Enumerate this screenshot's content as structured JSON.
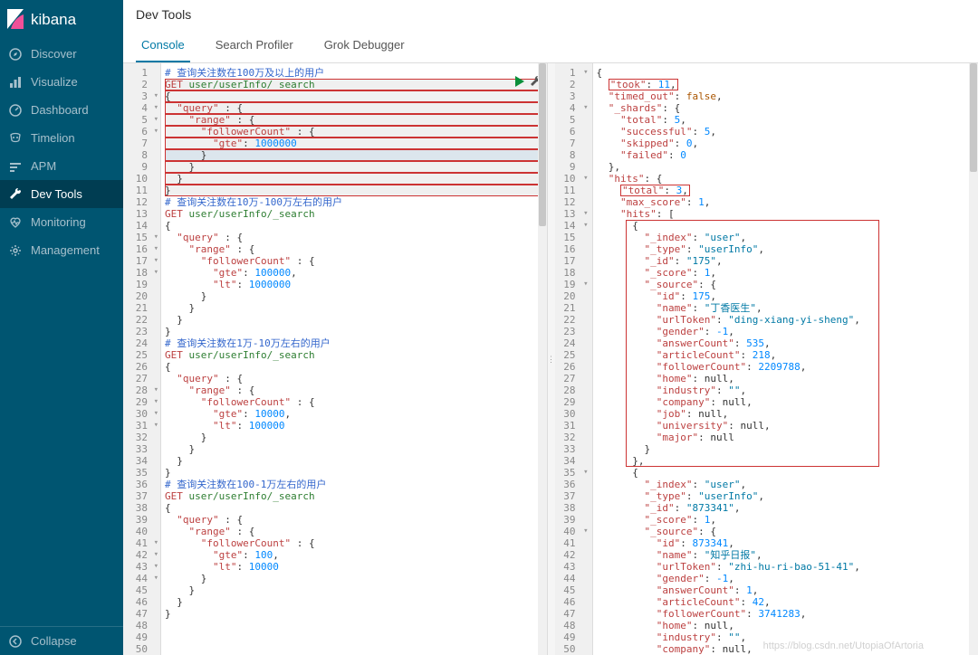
{
  "brand": {
    "name": "kibana"
  },
  "sidebar": {
    "items": [
      {
        "label": "Discover",
        "icon": "compass-icon"
      },
      {
        "label": "Visualize",
        "icon": "barchart-icon"
      },
      {
        "label": "Dashboard",
        "icon": "gauge-icon"
      },
      {
        "label": "Timelion",
        "icon": "timelion-icon"
      },
      {
        "label": "APM",
        "icon": "apm-icon"
      },
      {
        "label": "Dev Tools",
        "icon": "wrench-icon",
        "active": true
      },
      {
        "label": "Monitoring",
        "icon": "heartbeat-icon"
      },
      {
        "label": "Management",
        "icon": "gear-icon"
      }
    ],
    "collapse_label": "Collapse"
  },
  "header": {
    "title": "Dev Tools",
    "tabs": [
      {
        "label": "Console",
        "active": true
      },
      {
        "label": "Search Profiler"
      },
      {
        "label": "Grok Debugger"
      }
    ]
  },
  "editor": {
    "active_region": {
      "from": 2,
      "to": 12
    },
    "lines": [
      {
        "n": 1,
        "type": "comment",
        "text": "# 查询关注数在100万及以上的用户"
      },
      {
        "n": 2,
        "type": "request",
        "method": "GET",
        "path": "user/userInfo/_search"
      },
      {
        "n": 3,
        "type": "brace_open",
        "text": "{"
      },
      {
        "n": 4,
        "type": "kv_open",
        "indent": 1,
        "key": "query"
      },
      {
        "n": 5,
        "type": "kv_open",
        "indent": 2,
        "key": "range"
      },
      {
        "n": 6,
        "type": "kv_open",
        "indent": 3,
        "key": "followerCount"
      },
      {
        "n": 7,
        "type": "kv_num",
        "indent": 4,
        "key": "gte",
        "val": 1000000
      },
      {
        "n": 8,
        "type": "brace_close",
        "indent": 3,
        "highlight": true
      },
      {
        "n": 9,
        "type": "brace_close",
        "indent": 2
      },
      {
        "n": 10,
        "type": "brace_close",
        "indent": 1
      },
      {
        "n": 11,
        "type": "brace_close",
        "indent": 0
      },
      {
        "n": 12,
        "type": "blank"
      },
      {
        "n": 13,
        "type": "comment",
        "text": "# 查询关注数在10万-100万左右的用户"
      },
      {
        "n": 14,
        "type": "request",
        "method": "GET",
        "path": "user/userInfo/_search"
      },
      {
        "n": 15,
        "type": "brace_open",
        "text": "{"
      },
      {
        "n": 16,
        "type": "kv_open",
        "indent": 1,
        "key": "query"
      },
      {
        "n": 17,
        "type": "kv_open",
        "indent": 2,
        "key": "range"
      },
      {
        "n": 18,
        "type": "kv_open",
        "indent": 3,
        "key": "followerCount"
      },
      {
        "n": 19,
        "type": "kv_num_comma",
        "indent": 4,
        "key": "gte",
        "val": 100000
      },
      {
        "n": 20,
        "type": "kv_num",
        "indent": 4,
        "key": "lt",
        "val": 1000000
      },
      {
        "n": 21,
        "type": "brace_close",
        "indent": 3
      },
      {
        "n": 22,
        "type": "brace_close",
        "indent": 2
      },
      {
        "n": 23,
        "type": "brace_close",
        "indent": 1
      },
      {
        "n": 24,
        "type": "brace_close",
        "indent": 0
      },
      {
        "n": 25,
        "type": "blank"
      },
      {
        "n": 26,
        "type": "comment",
        "text": "# 查询关注数在1万-10万左右的用户"
      },
      {
        "n": 27,
        "type": "request",
        "method": "GET",
        "path": "user/userInfo/_search"
      },
      {
        "n": 28,
        "type": "brace_open",
        "text": "{"
      },
      {
        "n": 29,
        "type": "kv_open",
        "indent": 1,
        "key": "query"
      },
      {
        "n": 30,
        "type": "kv_open",
        "indent": 2,
        "key": "range"
      },
      {
        "n": 31,
        "type": "kv_open",
        "indent": 3,
        "key": "followerCount"
      },
      {
        "n": 32,
        "type": "kv_num_comma",
        "indent": 4,
        "key": "gte",
        "val": 10000
      },
      {
        "n": 33,
        "type": "kv_num",
        "indent": 4,
        "key": "lt",
        "val": 100000
      },
      {
        "n": 34,
        "type": "brace_close",
        "indent": 3
      },
      {
        "n": 35,
        "type": "brace_close",
        "indent": 2
      },
      {
        "n": 36,
        "type": "brace_close",
        "indent": 1
      },
      {
        "n": 37,
        "type": "brace_close",
        "indent": 0
      },
      {
        "n": 38,
        "type": "blank"
      },
      {
        "n": 39,
        "type": "comment",
        "text": "# 查询关注数在100-1万左右的用户"
      },
      {
        "n": 40,
        "type": "request",
        "method": "GET",
        "path": "user/userInfo/_search"
      },
      {
        "n": 41,
        "type": "brace_open",
        "text": "{"
      },
      {
        "n": 42,
        "type": "kv_open",
        "indent": 1,
        "key": "query"
      },
      {
        "n": 43,
        "type": "kv_open",
        "indent": 2,
        "key": "range"
      },
      {
        "n": 44,
        "type": "kv_open",
        "indent": 3,
        "key": "followerCount"
      },
      {
        "n": 45,
        "type": "kv_num_comma",
        "indent": 4,
        "key": "gte",
        "val": 100
      },
      {
        "n": 46,
        "type": "kv_num",
        "indent": 4,
        "key": "lt",
        "val": 10000
      },
      {
        "n": 47,
        "type": "brace_close",
        "indent": 3
      },
      {
        "n": 48,
        "type": "brace_close",
        "indent": 2
      },
      {
        "n": 49,
        "type": "brace_close",
        "indent": 1
      },
      {
        "n": 50,
        "type": "brace_close",
        "indent": 0
      }
    ]
  },
  "response": {
    "lines": [
      {
        "n": 1,
        "raw": "{",
        "fold": true
      },
      {
        "n": 2,
        "raw": "  &quot;took&quot;: 11,",
        "redbox": true,
        "kv": {
          "key": "took",
          "num": 11,
          "comma": true
        }
      },
      {
        "n": 3,
        "kv": {
          "key": "timed_out",
          "bool": "false",
          "comma": true
        },
        "indent": 1
      },
      {
        "n": 4,
        "kv": {
          "key": "_shards",
          "open": true
        },
        "indent": 1,
        "fold": true
      },
      {
        "n": 5,
        "kv": {
          "key": "total",
          "num": 5,
          "comma": true
        },
        "indent": 2
      },
      {
        "n": 6,
        "kv": {
          "key": "successful",
          "num": 5,
          "comma": true
        },
        "indent": 2
      },
      {
        "n": 7,
        "kv": {
          "key": "skipped",
          "num": 0,
          "comma": true
        },
        "indent": 2
      },
      {
        "n": 8,
        "kv": {
          "key": "failed",
          "num": 0
        },
        "indent": 2
      },
      {
        "n": 9,
        "raw": "  },",
        "close": true,
        "indent": 1
      },
      {
        "n": 10,
        "kv": {
          "key": "hits",
          "open": true
        },
        "indent": 1,
        "fold": true
      },
      {
        "n": 11,
        "kv": {
          "key": "total",
          "num": 3,
          "comma": true
        },
        "indent": 2,
        "redbox": true
      },
      {
        "n": 12,
        "kv": {
          "key": "max_score",
          "num": 1,
          "comma": true
        },
        "indent": 2
      },
      {
        "n": 13,
        "kv": {
          "key": "hits",
          "arr_open": true
        },
        "indent": 2,
        "fold": true
      },
      {
        "n": 14,
        "raw": "      {",
        "indent": 3,
        "fold": true,
        "redbox_start": true
      },
      {
        "n": 15,
        "kv": {
          "key": "_index",
          "str": "user",
          "comma": true
        },
        "indent": 4
      },
      {
        "n": 16,
        "kv": {
          "key": "_type",
          "str": "userInfo",
          "comma": true
        },
        "indent": 4
      },
      {
        "n": 17,
        "kv": {
          "key": "_id",
          "str": "175",
          "comma": true
        },
        "indent": 4
      },
      {
        "n": 18,
        "kv": {
          "key": "_score",
          "num": 1,
          "comma": true
        },
        "indent": 4
      },
      {
        "n": 19,
        "kv": {
          "key": "_source",
          "open": true
        },
        "indent": 4,
        "fold": true
      },
      {
        "n": 20,
        "kv": {
          "key": "id",
          "num": 175,
          "comma": true
        },
        "indent": 5
      },
      {
        "n": 21,
        "kv": {
          "key": "name",
          "str": "丁香医生",
          "comma": true
        },
        "indent": 5
      },
      {
        "n": 22,
        "kv": {
          "key": "urlToken",
          "str": "ding-xiang-yi-sheng",
          "comma": true
        },
        "indent": 5
      },
      {
        "n": 23,
        "kv": {
          "key": "gender",
          "num": -1,
          "comma": true
        },
        "indent": 5
      },
      {
        "n": 24,
        "kv": {
          "key": "answerCount",
          "num": 535,
          "comma": true
        },
        "indent": 5
      },
      {
        "n": 25,
        "kv": {
          "key": "articleCount",
          "num": 218,
          "comma": true
        },
        "indent": 5
      },
      {
        "n": 26,
        "kv": {
          "key": "followerCount",
          "num": 2209788,
          "comma": true
        },
        "indent": 5
      },
      {
        "n": 27,
        "kv": {
          "key": "home",
          "null": true,
          "comma": true
        },
        "indent": 5
      },
      {
        "n": 28,
        "kv": {
          "key": "industry",
          "str": "",
          "comma": true
        },
        "indent": 5
      },
      {
        "n": 29,
        "kv": {
          "key": "company",
          "null": true,
          "comma": true
        },
        "indent": 5
      },
      {
        "n": 30,
        "kv": {
          "key": "job",
          "null": true,
          "comma": true
        },
        "indent": 5
      },
      {
        "n": 31,
        "kv": {
          "key": "university",
          "null": true,
          "comma": true
        },
        "indent": 5
      },
      {
        "n": 32,
        "kv": {
          "key": "major",
          "null": true
        },
        "indent": 5
      },
      {
        "n": 33,
        "raw": "        }",
        "close": true,
        "indent": 4
      },
      {
        "n": 34,
        "raw": "      },",
        "close": true,
        "indent": 3,
        "redbox_end": true
      },
      {
        "n": 35,
        "raw": "      {",
        "indent": 3,
        "fold": true
      },
      {
        "n": 36,
        "kv": {
          "key": "_index",
          "str": "user",
          "comma": true
        },
        "indent": 4
      },
      {
        "n": 37,
        "kv": {
          "key": "_type",
          "str": "userInfo",
          "comma": true
        },
        "indent": 4
      },
      {
        "n": 38,
        "kv": {
          "key": "_id",
          "str": "873341",
          "comma": true
        },
        "indent": 4
      },
      {
        "n": 39,
        "kv": {
          "key": "_score",
          "num": 1,
          "comma": true
        },
        "indent": 4
      },
      {
        "n": 40,
        "kv": {
          "key": "_source",
          "open": true
        },
        "indent": 4,
        "fold": true
      },
      {
        "n": 41,
        "kv": {
          "key": "id",
          "num": 873341,
          "comma": true
        },
        "indent": 5
      },
      {
        "n": 42,
        "kv": {
          "key": "name",
          "str": "知乎日报",
          "comma": true
        },
        "indent": 5
      },
      {
        "n": 43,
        "kv": {
          "key": "urlToken",
          "str": "zhi-hu-ri-bao-51-41",
          "comma": true
        },
        "indent": 5
      },
      {
        "n": 44,
        "kv": {
          "key": "gender",
          "num": -1,
          "comma": true
        },
        "indent": 5
      },
      {
        "n": 45,
        "kv": {
          "key": "answerCount",
          "num": 1,
          "comma": true
        },
        "indent": 5
      },
      {
        "n": 46,
        "kv": {
          "key": "articleCount",
          "num": 42,
          "comma": true
        },
        "indent": 5
      },
      {
        "n": 47,
        "kv": {
          "key": "followerCount",
          "num": 3741283,
          "comma": true
        },
        "indent": 5
      },
      {
        "n": 48,
        "kv": {
          "key": "home",
          "null": true,
          "comma": true
        },
        "indent": 5
      },
      {
        "n": 49,
        "kv": {
          "key": "industry",
          "str": "",
          "comma": true
        },
        "indent": 5
      },
      {
        "n": 50,
        "kv": {
          "key": "company",
          "null": true,
          "comma": true
        },
        "indent": 5
      }
    ]
  },
  "watermark": "https://blog.csdn.net/UtopiaOfArtoria"
}
